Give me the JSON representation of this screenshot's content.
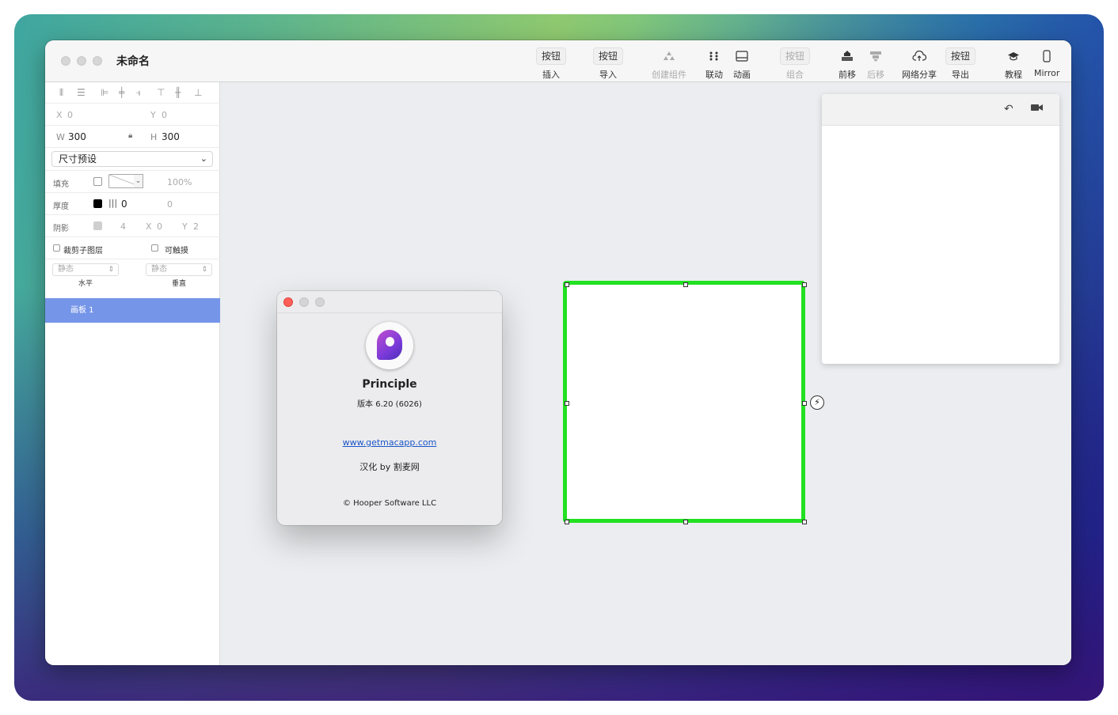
{
  "window": {
    "title": "未命名"
  },
  "toolbar": {
    "insert": {
      "button": "按钮",
      "label": "插入"
    },
    "import": {
      "button": "按钮",
      "label": "导入"
    },
    "create_component": {
      "label": "创建组件"
    },
    "link": {
      "label": "联动"
    },
    "animate": {
      "label": "动画"
    },
    "group": {
      "button": "按钮",
      "label": "组合"
    },
    "bring_forward": {
      "label": "前移"
    },
    "send_backward": {
      "label": "后移"
    },
    "share": {
      "label": "网络分享"
    },
    "export": {
      "button": "按钮",
      "label": "导出"
    },
    "tutorial": {
      "label": "教程"
    },
    "mirror": {
      "label": "Mirror"
    }
  },
  "inspector": {
    "x_label": "X",
    "x_value": "0",
    "y_label": "Y",
    "y_value": "0",
    "w_label": "W",
    "w_value": "300",
    "h_label": "H",
    "h_value": "300",
    "size_preset": "尺寸预设",
    "fill_label": "填充",
    "fill_opacity": "100%",
    "border_label": "厚度",
    "border_width": "0",
    "border_extra": "0",
    "shadow_label": "阴影",
    "shadow_blur": "4",
    "shadow_x_label": "X",
    "shadow_x": "0",
    "shadow_y_label": "Y",
    "shadow_y": "2",
    "clip_sublayers": "裁剪子图层",
    "touchable": "可触摸",
    "h_state": "静态",
    "h_state_label": "水平",
    "v_state": "静态",
    "v_state_label": "垂直"
  },
  "layers": [
    {
      "name": "画板 1",
      "selected": true
    }
  ],
  "about": {
    "app_name": "Principle",
    "version": "版本 6.20 (6026)",
    "link": "www.getmacapp.com",
    "credit": "汉化 by 割麦网",
    "copyright": "© Hooper Software LLC"
  },
  "colors": {
    "selection": "#22e122",
    "layer_selected": "#7595e8",
    "close_button": "#fe5f57"
  }
}
